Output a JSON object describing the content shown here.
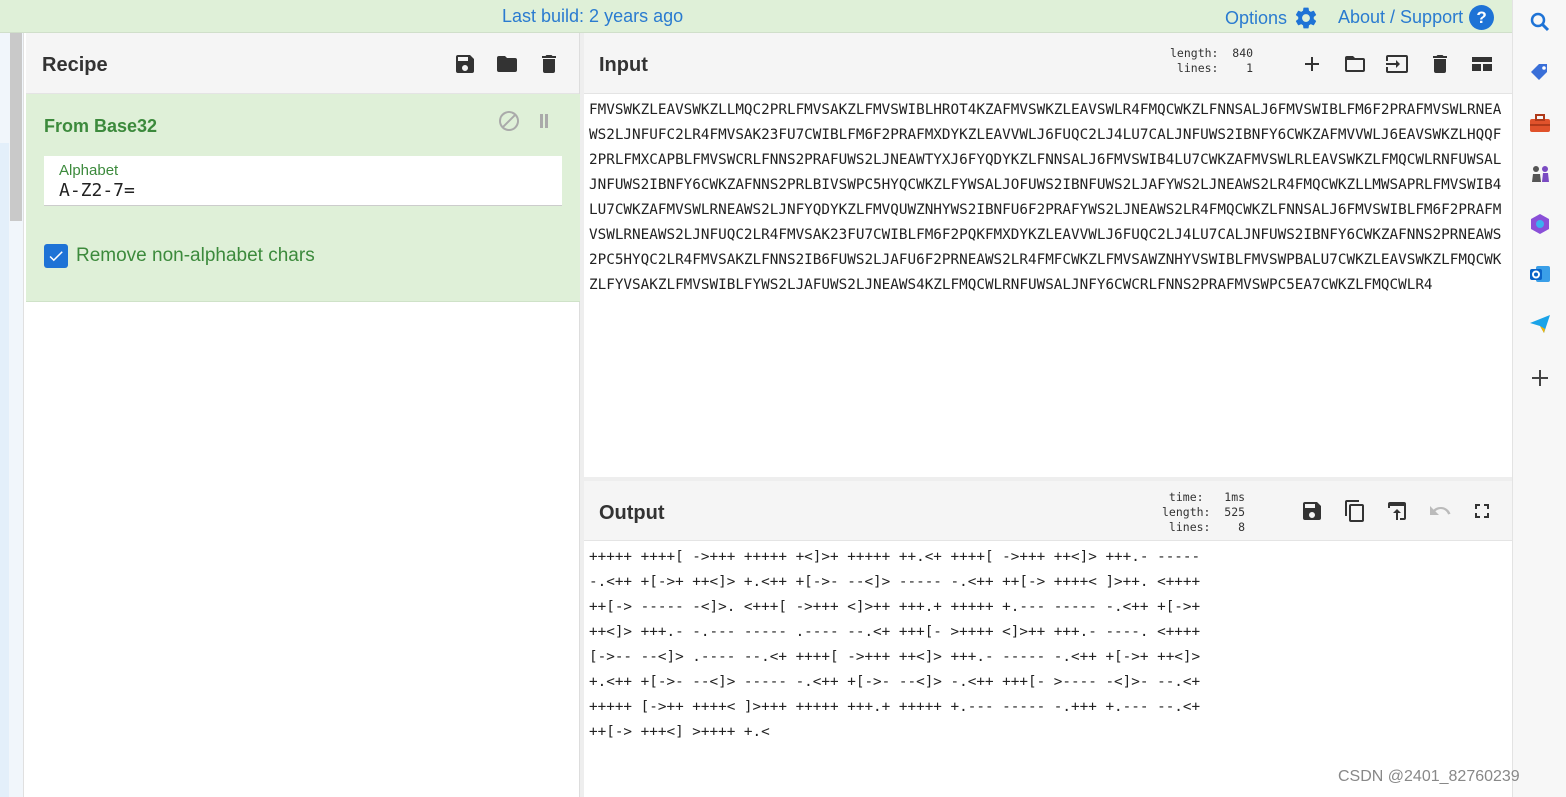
{
  "topbar": {
    "build": "Last build: 2 years ago",
    "options": "Options",
    "about": "About / Support",
    "help_glyph": "?"
  },
  "recipe": {
    "title": "Recipe",
    "operation": {
      "name": "From Base32",
      "alphabet_label": "Alphabet",
      "alphabet_value": "A-Z2-7=",
      "checkbox_label": "Remove non-alphabet chars",
      "checkbox_checked": true
    }
  },
  "input": {
    "title": "Input",
    "stats": "length:  840\nlines:    1",
    "text": "FMVSWKZLEAVSWKZLLMQC2PRLFMVSAKZLFMVSWIBLHROT4KZAFMVSWKZLEAVSWLR4FMQCWKZLFNNSALJ6FMVSWIBLFM6F2PRAFMVSWLRNEAWS2LJNFUFC2LR4FMVSAK23FU7CWIBLFM6F2PRAFMXDYKZLEAVVWLJ6FUQC2LJ4LU7CALJNFUWS2IBNFY6CWKZAFMVVWLJ6EAVSWKZLHQQF2PRLFMXCAPBLFMVSWCRLFNNS2PRAFUWS2LJNEAWTYXJ6FYQDYKZLFNNSALJ6FMVSWIB4LU7CWKZAFMVSWLRLEAVSWKZLFMQCWLRNFUWSALJNFUWS2IBNFY6CWKZAFNNS2PRLBIVSWPC5HYQCWKZLFYWSALJOFUWS2IBNFUWS2LJAFYWS2LJNEAWS2LR4FMQCWKZLLMWSAPRLFMVSWIB4LU7CWKZAFMVSWLRNEAWS2LJNFYQDYKZLFMVQUWZNHYWS2IBNFU6F2PRAFYWS2LJNEAWS2LR4FMQCWKZLFNNSALJ6FMVSWIBLFM6F2PRAFMVSWLRNEAWS2LJNFUQC2LR4FMVSAK23FU7CWIBLFM6F2PQKFMXDYKZLEAVVWLJ6FUQC2LJ4LU7CALJNFUWS2IBNFY6CWKZAFNNS2PRNEAWS2PC5HYQC2LR4FMVSAKZLFNNS2IB6FUWS2LJAFU6F2PRNEAWS2LR4FMFCWKZLFMVSAWZNHYVSWIBLFMVSWPBALU7CWKZLEAVSWKZLFMQCWKZLFYVSAKZLFMVSWIBLFYWS2LJAFUWS2LJNEAWS4KZLFMQCWLRNFUWSALJNFY6CWCRLFNNS2PRAFMVSWPC5EA7CWKZLFMQCWLR4"
  },
  "output": {
    "title": "Output",
    "stats": "time:   1ms\nlength:  525\nlines:    8",
    "text": "+++++ ++++[ ->+++ +++++ +<]>+ +++++ ++.<+ ++++[ ->+++ ++<]> +++.- -----\n-.<++ +[->+ ++<]> +.<++ +[->- --<]> ----- -.<++ ++[-> ++++< ]>++. <++++\n++[-> ----- -<]>. <+++[ ->+++ <]>++ +++.+ +++++ +.--- ----- -.<++ +[->+\n++<]> +++.- -.--- ----- .---- --.<+ +++[- >++++ <]>++ +++.- ----. <++++\n[->-- --<]> .---- --.<+ ++++[ ->+++ ++<]> +++.- ----- -.<++ +[->+ ++<]>\n+.<++ +[->- --<]> ----- -.<++ +[->- --<]> -.<++ +++[- >---- -<]>- --.<+\n+++++ [->++ ++++< ]>+++ +++++ +++.+ +++++ +.--- ----- -.+++ +.--- --.<+\n++[-> +++<] >++++ +.<"
  },
  "watermark": "CSDN @2401_82760239"
}
